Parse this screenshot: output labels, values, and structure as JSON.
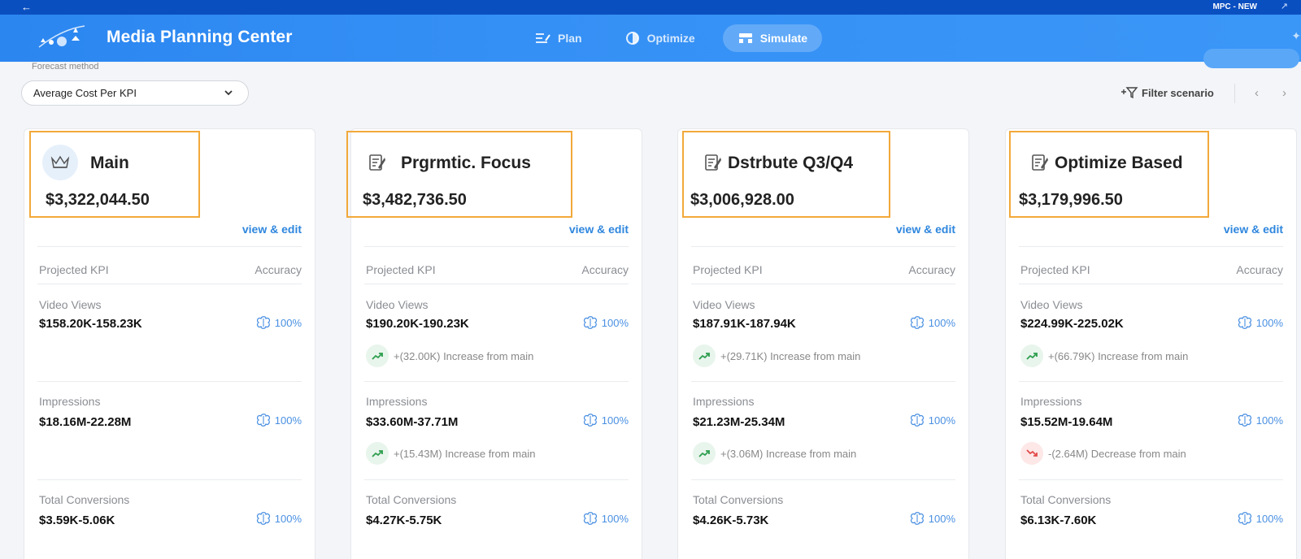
{
  "titlebar": {
    "title": "MPC - NEW"
  },
  "header": {
    "app_name": "Media Planning Center",
    "nav": [
      {
        "label": "Plan",
        "icon": "plan-icon",
        "active": false
      },
      {
        "label": "Optimize",
        "icon": "optimize-icon",
        "active": false
      },
      {
        "label": "Simulate",
        "icon": "simulate-icon",
        "active": true
      }
    ]
  },
  "toolbar": {
    "forecast_label": "Forecast method",
    "forecast_value": "Average Cost Per KPI",
    "filter_label": "Filter scenario"
  },
  "columns": {
    "kpi": "Projected KPI",
    "accuracy": "Accuracy"
  },
  "view_edit_label": "view & edit",
  "scenarios": [
    {
      "name": "Main",
      "icon": "crown-icon",
      "amount": "$3,322,044.50",
      "kpis": [
        {
          "name": "Video Views",
          "value": "$158.20K-158.23K",
          "accuracy": "100%"
        },
        {
          "name": "Impressions",
          "value": "$18.16M-22.28M",
          "accuracy": "100%"
        },
        {
          "name": "Total Conversions",
          "value": "$3.59K-5.06K",
          "accuracy": "100%"
        }
      ]
    },
    {
      "name": "Prgrmtic. Focus",
      "icon": "edit-document-icon",
      "amount": "$3,482,736.50",
      "kpis": [
        {
          "name": "Video Views",
          "value": "$190.20K-190.23K",
          "accuracy": "100%",
          "delta": "+(32.00K) Increase from main",
          "direction": "up"
        },
        {
          "name": "Impressions",
          "value": "$33.60M-37.71M",
          "accuracy": "100%",
          "delta": "+(15.43M) Increase from main",
          "direction": "up"
        },
        {
          "name": "Total Conversions",
          "value": "$4.27K-5.75K",
          "accuracy": "100%"
        }
      ]
    },
    {
      "name": "Dstrbute Q3/Q4",
      "icon": "edit-document-icon",
      "amount": "$3,006,928.00",
      "kpis": [
        {
          "name": "Video Views",
          "value": "$187.91K-187.94K",
          "accuracy": "100%",
          "delta": "+(29.71K) Increase from main",
          "direction": "up"
        },
        {
          "name": "Impressions",
          "value": "$21.23M-25.34M",
          "accuracy": "100%",
          "delta": "+(3.06M) Increase from main",
          "direction": "up"
        },
        {
          "name": "Total Conversions",
          "value": "$4.26K-5.73K",
          "accuracy": "100%"
        }
      ]
    },
    {
      "name": "Optimize Based",
      "icon": "edit-document-icon",
      "amount": "$3,179,996.50",
      "kpis": [
        {
          "name": "Video Views",
          "value": "$224.99K-225.02K",
          "accuracy": "100%",
          "delta": "+(66.79K) Increase from main",
          "direction": "up"
        },
        {
          "name": "Impressions",
          "value": "$15.52M-19.64M",
          "accuracy": "100%",
          "delta": "-(2.64M) Decrease from main",
          "direction": "down"
        },
        {
          "name": "Total Conversions",
          "value": "$6.13K-7.60K",
          "accuracy": "100%"
        }
      ]
    }
  ],
  "colors": {
    "header": "#3590f5",
    "highlight": "#f2a93b",
    "link": "#2e86de",
    "up": "#2e9e4f",
    "down": "#e24a4a"
  }
}
